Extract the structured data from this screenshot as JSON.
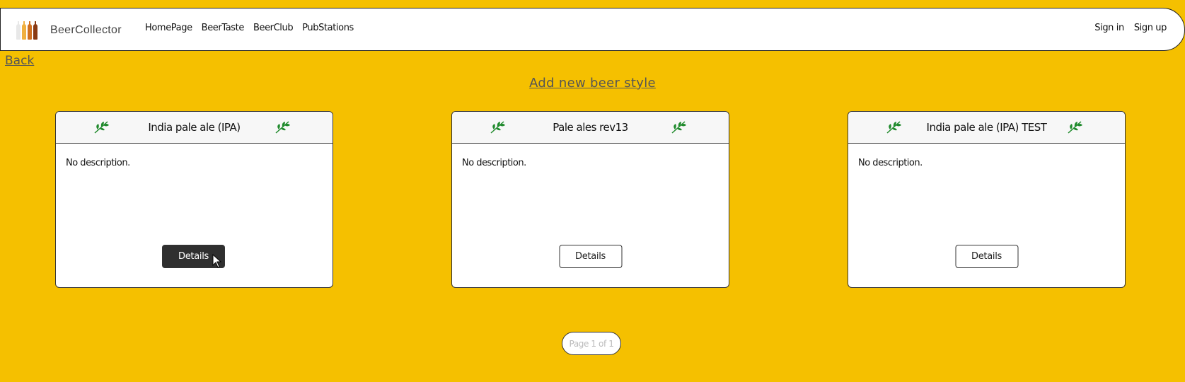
{
  "navbar": {
    "brand": "BeerCollector",
    "links": [
      "HomePage",
      "BeerTaste",
      "BeerClub",
      "PubStations"
    ],
    "auth": [
      "Sign in",
      "Sign up"
    ],
    "bottle_colors": [
      "#e8e8e8",
      "#f0b040",
      "#d07020",
      "#8a3a12"
    ]
  },
  "back_label": "Back",
  "add_label": "Add new beer style",
  "cards": [
    {
      "title": "India pale ale (IPA)",
      "description": "No description.",
      "button": "Details"
    },
    {
      "title": "Pale ales rev13",
      "description": "No description.",
      "button": "Details"
    },
    {
      "title": "India pale ale (IPA) TEST",
      "description": "No description.",
      "button": "Details"
    }
  ],
  "pagination": "Page 1 of 1",
  "colors": {
    "background": "#f5c000",
    "leaf": "#1f8a2c",
    "active_button": "#2f2f2f"
  },
  "icons": {
    "card_decoration": "hop-leaf-icon",
    "pointer": "mouse-cursor-icon"
  }
}
